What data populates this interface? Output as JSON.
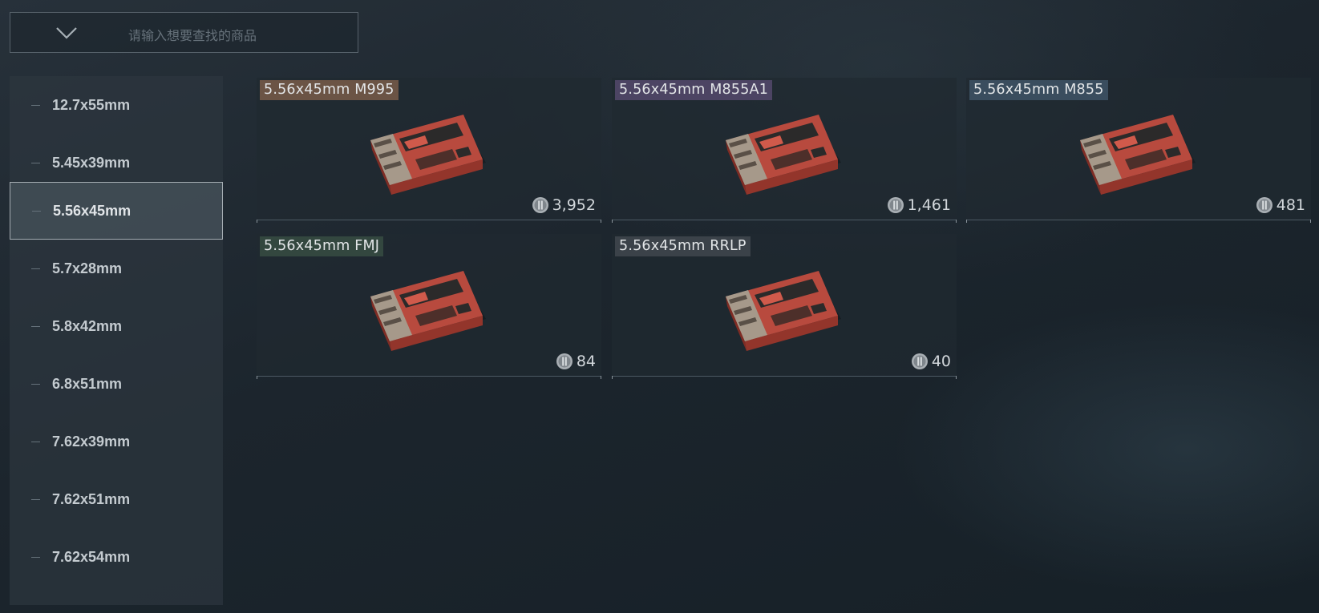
{
  "search": {
    "placeholder": "请输入想要查找的商品",
    "dropdown_icon": "chevron-down-icon"
  },
  "sidebar": {
    "items": [
      {
        "label": "12.7x55mm",
        "active": false
      },
      {
        "label": "5.45x39mm",
        "active": false
      },
      {
        "label": "5.56x45mm",
        "active": true
      },
      {
        "label": "5.7x28mm",
        "active": false
      },
      {
        "label": "5.8x42mm",
        "active": false
      },
      {
        "label": "6.8x51mm",
        "active": false
      },
      {
        "label": "7.62x39mm",
        "active": false
      },
      {
        "label": "7.62x51mm",
        "active": false
      },
      {
        "label": "7.62x54mm",
        "active": false
      }
    ]
  },
  "items": [
    {
      "name": "5.56x45mm M995",
      "price": "3,952",
      "tag_color": "#6b5445",
      "icon": "ammo-box-icon"
    },
    {
      "name": "5.56x45mm M855A1",
      "price": "1,461",
      "tag_color": "#4c4463",
      "icon": "ammo-box-icon"
    },
    {
      "name": "5.56x45mm M855",
      "price": "481",
      "tag_color": "#3a4d5e",
      "icon": "ammo-box-icon"
    },
    {
      "name": "5.56x45mm FMJ",
      "price": "84",
      "tag_color": "#33473f",
      "icon": "ammo-box-icon"
    },
    {
      "name": "5.56x45mm RRLP",
      "price": "40",
      "tag_color": "#3b4249",
      "icon": "ammo-box-icon"
    }
  ],
  "colors": {
    "accent_active_border": "#a5adb3",
    "box_red": "#b84a3e",
    "coin": "#a9afb4"
  }
}
